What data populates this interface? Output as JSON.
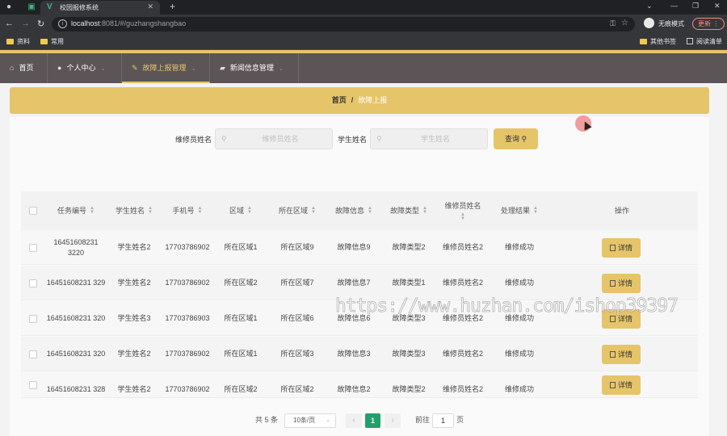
{
  "browser": {
    "tab_title": "校园报修系统",
    "url_host": "localhost",
    "url_rest": ":8081/#/guzhangshangbao",
    "profile_label": "无痕模式",
    "update_label": "更新",
    "bookmarks": [
      "资料",
      "常用"
    ],
    "other_bookmarks": "其他书签",
    "reading_list": "阅读清单"
  },
  "nav": {
    "items": [
      {
        "label": "首页",
        "icon": "home-icon"
      },
      {
        "label": "个人中心",
        "icon": "user-icon"
      },
      {
        "label": "故障上报管理",
        "icon": "edit-icon"
      },
      {
        "label": "新闻信息管理",
        "icon": "news-icon"
      }
    ],
    "active_index": 2
  },
  "breadcrumb": {
    "home": "首页",
    "separator": "/",
    "current": "故障上报"
  },
  "search": {
    "repair_label": "维修员姓名",
    "repair_placeholder": "维修员姓名",
    "student_label": "学生姓名",
    "student_placeholder": "学生姓名",
    "query_label": "查询"
  },
  "table": {
    "columns": [
      "任务编号",
      "学生姓名",
      "手机号",
      "区域",
      "所在区域",
      "故障信息",
      "故障类型",
      "维修员姓名",
      "处理结果",
      "操作"
    ],
    "rows": [
      {
        "task_no": "16451608231 3220",
        "student": "学生姓名2",
        "phone": "17703786902",
        "area": "所在区域1",
        "location": "所在区域9",
        "fault": "故障信息9",
        "fault_type": "故障类型2",
        "repairer": "维修员姓名2",
        "result": "维修成功",
        "action": "详情"
      },
      {
        "task_no": "16451608231 329",
        "student": "学生姓名2",
        "phone": "17703786902",
        "area": "所在区域2",
        "location": "所在区域7",
        "fault": "故障信息7",
        "fault_type": "故障类型1",
        "repairer": "维修员姓名2",
        "result": "维修成功",
        "action": "详情"
      },
      {
        "task_no": "16451608231 320",
        "student": "学生姓名3",
        "phone": "17703786903",
        "area": "所在区域1",
        "location": "所在区域6",
        "fault": "故障信息6",
        "fault_type": "故障类型3",
        "repairer": "维修员姓名2",
        "result": "维修成功",
        "action": "详情"
      },
      {
        "task_no": "16451608231 320",
        "student": "学生姓名2",
        "phone": "17703786902",
        "area": "所在区域1",
        "location": "所在区域3",
        "fault": "故障信息3",
        "fault_type": "故障类型3",
        "repairer": "维修员姓名2",
        "result": "维修成功",
        "action": "详情"
      },
      {
        "task_no": "16451608231 328",
        "student": "学生姓名2",
        "phone": "17703786902",
        "area": "所在区域2",
        "location": "所在区域2",
        "fault": "故障信息2",
        "fault_type": "故障类型2",
        "repairer": "维修员姓名2",
        "result": "维修成功",
        "action": "详情"
      }
    ]
  },
  "pagination": {
    "total": "共 5 条",
    "page_size": "10条/页",
    "current": "1",
    "goto_label": "前往",
    "goto_value": "1",
    "page_suffix": "页"
  },
  "watermark": "https://www.huzhan.com/ishop39397",
  "colors": {
    "accent": "#e6c469",
    "nav_bg": "#5b5558",
    "page_active": "#22a06b"
  }
}
